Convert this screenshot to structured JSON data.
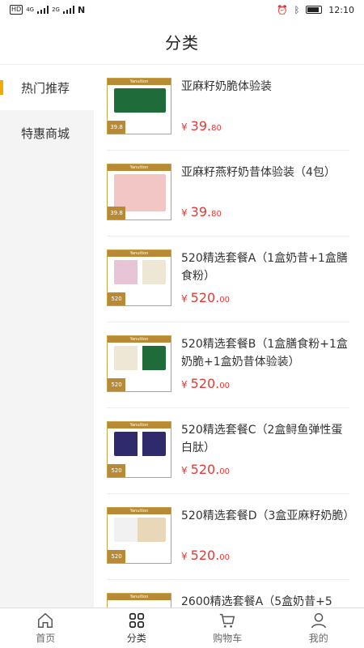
{
  "status": {
    "time": "12:10",
    "net1": "4G",
    "net2": "2G",
    "hd": "HD"
  },
  "header": {
    "title": "分类"
  },
  "sidebar": {
    "items": [
      {
        "label": "热门推荐"
      },
      {
        "label": "特惠商城"
      }
    ]
  },
  "products": [
    {
      "name": "亚麻籽奶脆体验装",
      "currency": "¥",
      "price_int": "39.",
      "price_dec": "80",
      "thumb_tag": "39.8"
    },
    {
      "name": "亚麻籽燕籽奶昔体验装（4包）",
      "currency": "¥",
      "price_int": "39.",
      "price_dec": "80",
      "thumb_tag": "39.8"
    },
    {
      "name": "520精选套餐A（1盒奶昔+1盒膳食粉）",
      "currency": "¥",
      "price_int": "520.",
      "price_dec": "00",
      "thumb_tag": "520"
    },
    {
      "name": "520精选套餐B（1盒膳食粉+1盒奶脆+1盒奶昔体验装）",
      "currency": "¥",
      "price_int": "520.",
      "price_dec": "00",
      "thumb_tag": "520"
    },
    {
      "name": "520精选套餐C（2盒鲟鱼弹性蛋白肽）",
      "currency": "¥",
      "price_int": "520.",
      "price_dec": "00",
      "thumb_tag": "520"
    },
    {
      "name": "520精选套餐D（3盒亚麻籽奶脆）",
      "currency": "¥",
      "price_int": "520.",
      "price_dec": "00",
      "thumb_tag": "520"
    },
    {
      "name": "2600精选套餐A（5盒奶昔+5",
      "currency": "¥",
      "price_int": "",
      "price_dec": "",
      "thumb_tag": ""
    }
  ],
  "thumb_brand": "Yanuition",
  "tabbar": {
    "items": [
      {
        "label": "首页"
      },
      {
        "label": "分类"
      },
      {
        "label": "购物车"
      },
      {
        "label": "我的"
      }
    ]
  },
  "colors": {
    "accent": "#f2a900",
    "price": "#e53935",
    "brand_gold": "#b98a36"
  }
}
